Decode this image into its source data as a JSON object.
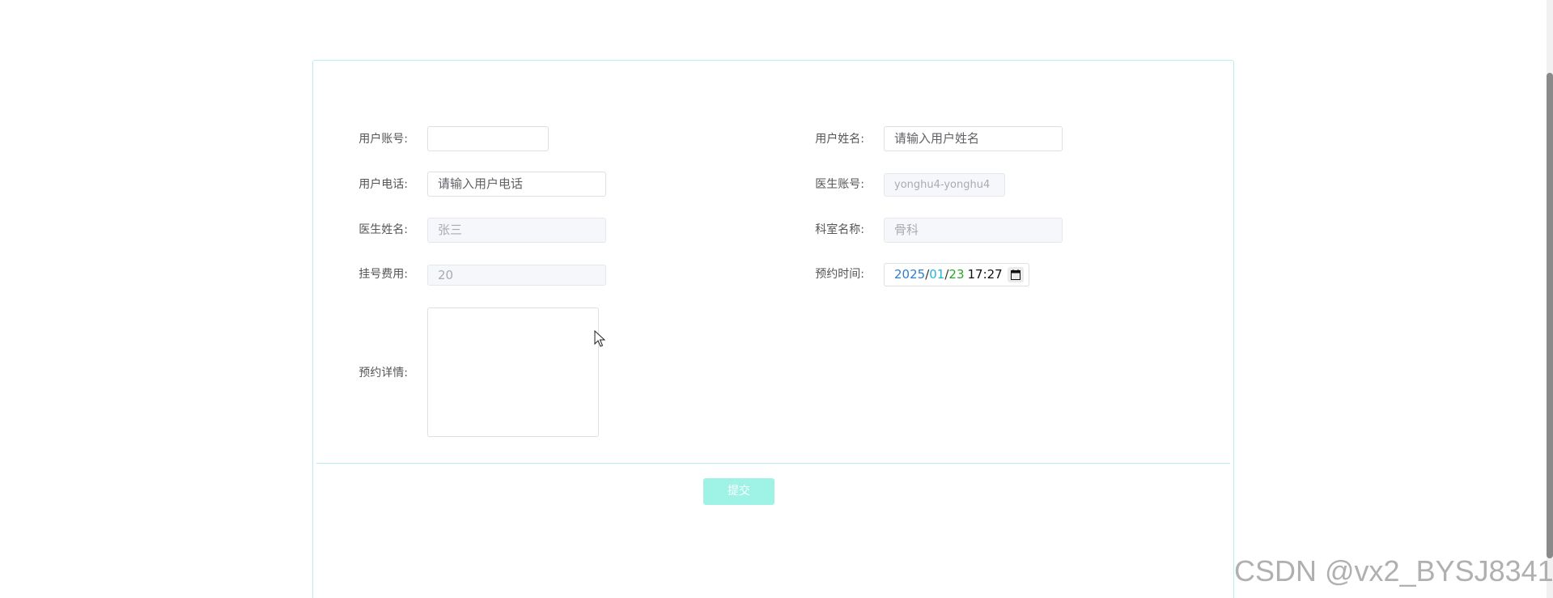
{
  "form": {
    "fields": {
      "user_account": {
        "label": "用户账号:",
        "value": "",
        "placeholder": ""
      },
      "user_name": {
        "label": "用户姓名:",
        "value": "",
        "placeholder": "请输入用户姓名"
      },
      "user_phone": {
        "label": "用户电话:",
        "value": "",
        "placeholder": "请输入用户电话"
      },
      "doctor_account": {
        "label": "医生账号:",
        "value": "yonghu4-yonghu4",
        "disabled": true
      },
      "doctor_name": {
        "label": "医生姓名:",
        "value": "张三",
        "disabled": true
      },
      "department_name": {
        "label": "科室名称:",
        "value": "骨科",
        "disabled": true
      },
      "registration_fee": {
        "label": "挂号费用:",
        "value": "20",
        "disabled": true
      },
      "appointment_time": {
        "label": "预约时间:",
        "year": "2025",
        "month": "01",
        "day": "23",
        "time": "17:27",
        "separator": "/",
        "icon": "calendar-icon"
      },
      "appointment_details": {
        "label": "预约详情:",
        "value": ""
      }
    },
    "submit_label": "提交"
  },
  "watermark": "CSDN @vx2_BYSJ8341",
  "colors": {
    "card_border": "#b4eef2",
    "submit_bg": "#9ef3e6",
    "date_year": "#2d7fd3",
    "date_month": "#21b6d4",
    "date_day": "#2aa52a"
  }
}
